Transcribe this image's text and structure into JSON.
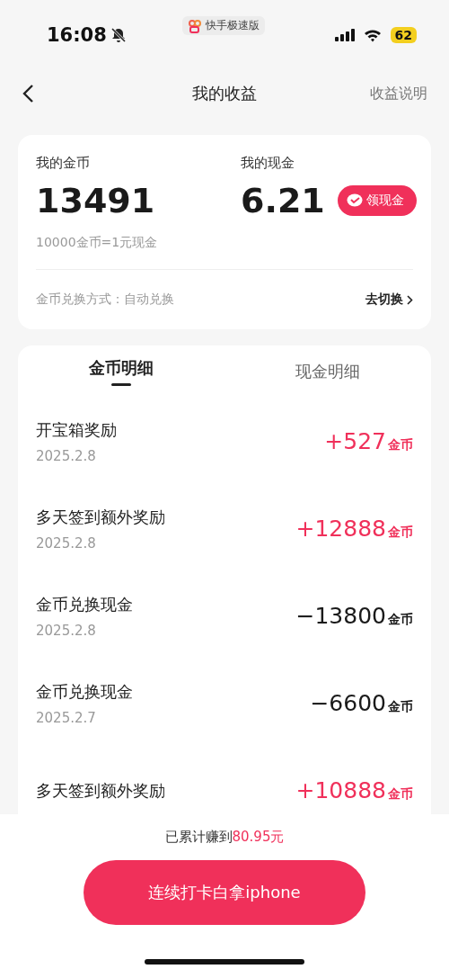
{
  "status_bar": {
    "time": "16:08",
    "app_name": "快手极速版",
    "battery": "62"
  },
  "nav": {
    "title": "我的收益",
    "action": "收益说明"
  },
  "summary": {
    "coins_label": "我的金币",
    "coins": "13491",
    "cash_label": "我的现金",
    "cash": "6.21",
    "withdraw_button": "领现金",
    "rate": "10000金币=1元现金",
    "mode_label": "金币兑换方式：自动兑换",
    "switch_link": "去切换"
  },
  "tabs": [
    {
      "label": "金币明细",
      "selected": true
    },
    {
      "label": "现金明细",
      "selected": false
    }
  ],
  "records": [
    {
      "title": "开宝箱奖励",
      "date": "2025.2.8",
      "amount": "+527",
      "unit": "金币",
      "kind": "income"
    },
    {
      "title": "多天签到额外奖励",
      "date": "2025.2.8",
      "amount": "+12888",
      "unit": "金币",
      "kind": "income"
    },
    {
      "title": "金币兑换现金",
      "date": "2025.2.8",
      "amount": "−13800",
      "unit": "金币",
      "kind": "expense"
    },
    {
      "title": "金币兑换现金",
      "date": "2025.2.7",
      "amount": "−6600",
      "unit": "金币",
      "kind": "expense"
    },
    {
      "title": "多天签到额外奖励",
      "amount": "+10888",
      "unit": "金币",
      "kind": "income"
    }
  ],
  "footer": {
    "earned_label": "已累计赚到",
    "earned_amount": "80.95元",
    "cta_button": "连续打卡白拿iphone"
  }
}
